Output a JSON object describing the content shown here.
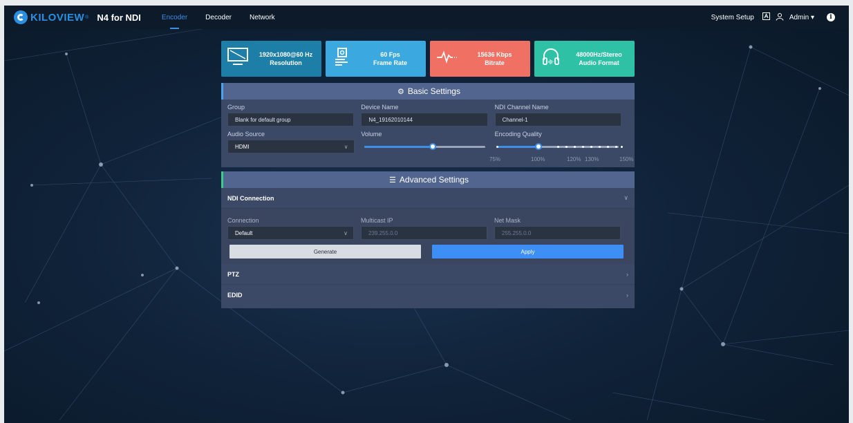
{
  "brand": {
    "logo_text": "KILOVIEW",
    "product": "N4 for NDI",
    "accent": "#3d8fe8"
  },
  "nav": [
    {
      "label": "Encoder",
      "active": true
    },
    {
      "label": "Decoder",
      "active": false
    },
    {
      "label": "Network",
      "active": false
    }
  ],
  "topbar": {
    "system_setup": "System Setup",
    "user": "Admin"
  },
  "cards": [
    {
      "line1": "1920x1080@60 Hz",
      "line2": "Resolution",
      "icon": "monitor-icon",
      "color": "#1d7fa8"
    },
    {
      "line1": "60 Fps",
      "line2": "Frame Rate",
      "icon": "camera-icon",
      "color": "#3ba8e0"
    },
    {
      "line1": "15636 Kbps",
      "line2": "Bitrate",
      "icon": "pulse-icon",
      "color": "#f07063"
    },
    {
      "line1": "48000Hz/Stereo",
      "line2": "Audio Format",
      "icon": "headphones-icon",
      "color": "#2fc1a6"
    }
  ],
  "basic": {
    "title": "Basic Settings",
    "labels": {
      "group": "Group",
      "device_name": "Device Name",
      "ndi_channel": "NDI Channel Name",
      "audio_source": "Audio Source",
      "volume": "Volume",
      "encoding_quality": "Encoding Quality"
    },
    "group_placeholder": "Blank for default group",
    "device_name": "N4_19162010144",
    "ndi_channel": "Channel-1",
    "audio_source": "HDMI",
    "volume_level": 0.55,
    "quality_ticks": [
      "75%",
      "100%",
      "120%",
      "130%",
      "150%"
    ],
    "quality_value": "100%"
  },
  "advanced": {
    "title": "Advanced Settings",
    "ndi_connection": {
      "title": "NDI Connection",
      "labels": {
        "connection": "Connection",
        "multicast_ip": "Multicast IP",
        "net_mask": "Net Mask"
      },
      "connection": "Default",
      "multicast_ip": "239.255.0.0",
      "net_mask": "255.255.0.0",
      "generate": "Generate",
      "apply": "Apply"
    },
    "ptz": "PTZ",
    "edid": "EDID"
  }
}
